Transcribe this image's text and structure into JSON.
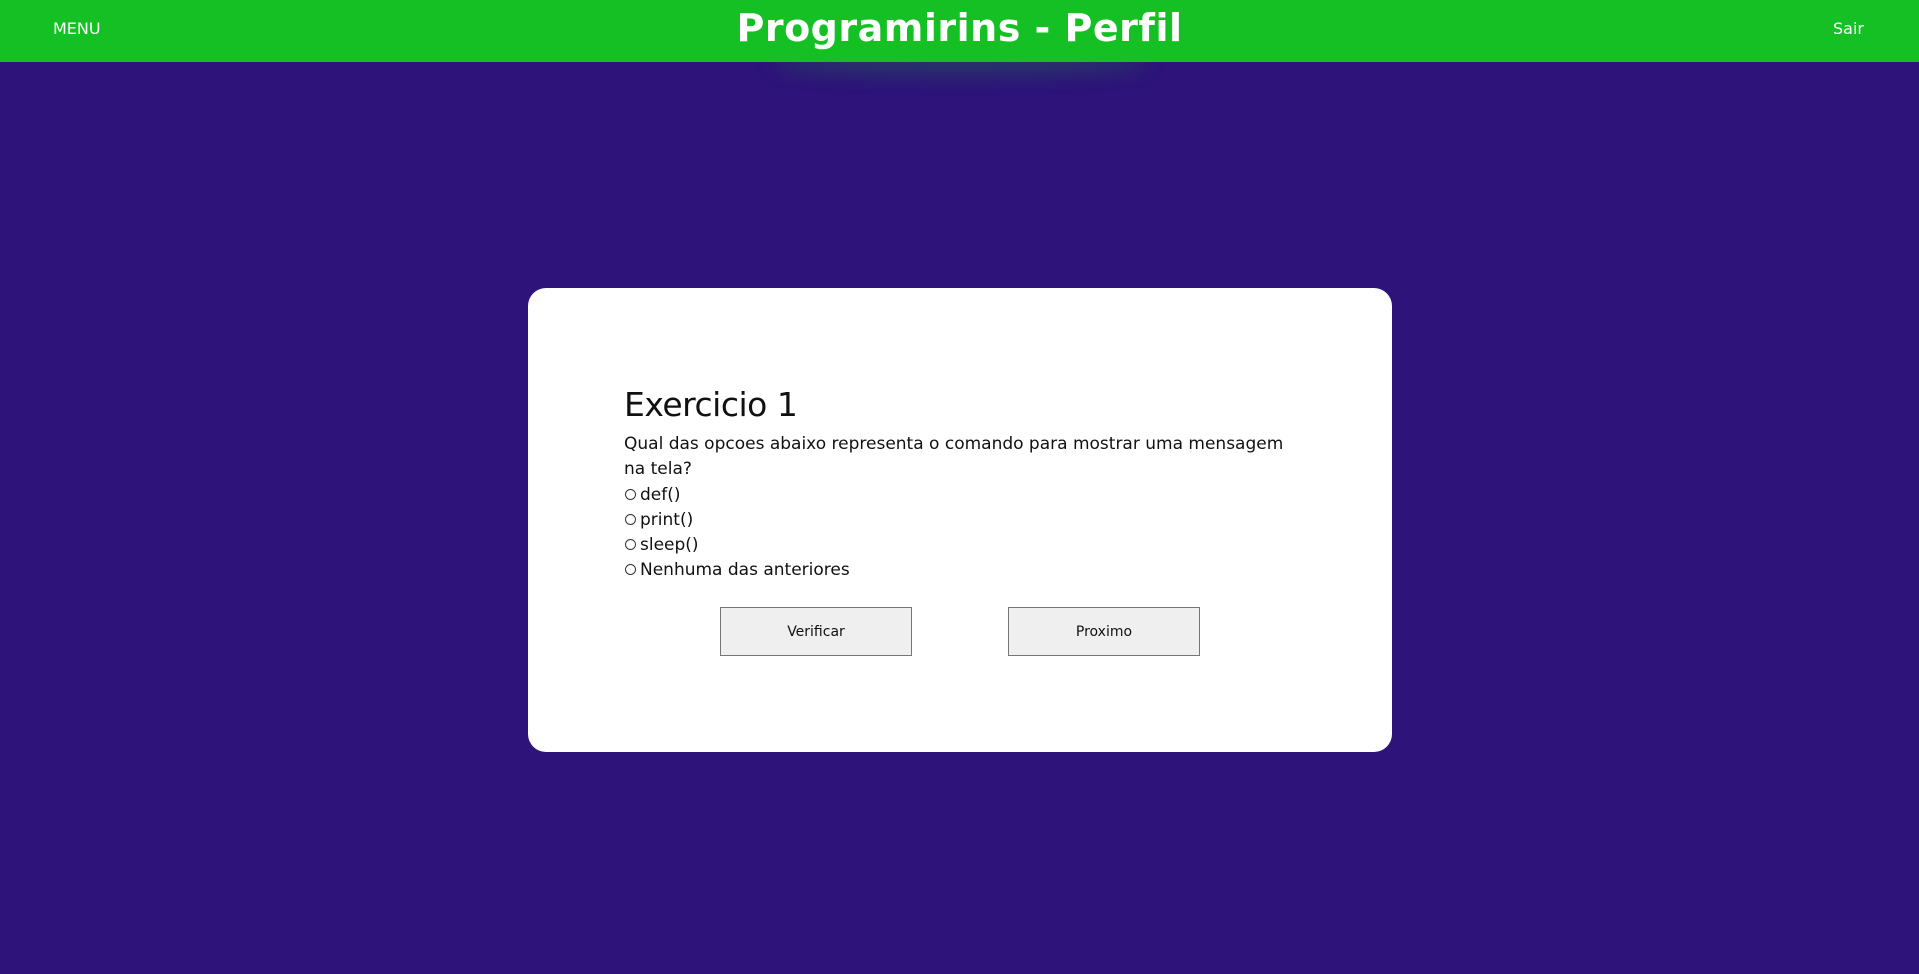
{
  "header": {
    "menu_label": "MENU",
    "title": "Programirins - Perfil",
    "logout_label": "Sair",
    "bar_color": "#15c024"
  },
  "page": {
    "background_color": "#2d137a"
  },
  "exercise": {
    "title": "Exercicio 1",
    "question": "Qual das opcoes abaixo representa o comando para mostrar uma mensagem na tela?",
    "options": [
      {
        "label": "def()",
        "selected": false
      },
      {
        "label": "print()",
        "selected": false
      },
      {
        "label": "sleep()",
        "selected": false
      },
      {
        "label": "Nenhuma das anteriores",
        "selected": false
      }
    ],
    "verify_button_label": "Verificar",
    "next_button_label": "Proximo"
  }
}
